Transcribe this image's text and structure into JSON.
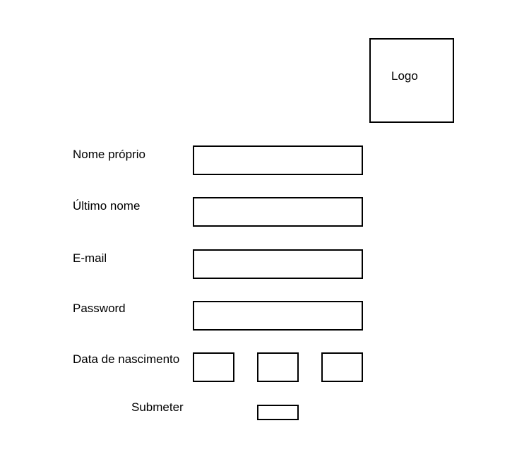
{
  "logo": {
    "text": "Logo"
  },
  "form": {
    "first_name_label": "Nome próprio",
    "last_name_label": "Último nome",
    "email_label": "E-mail",
    "password_label": "Password",
    "birthdate_label": "Data de nascimento",
    "submit_label": "Submeter"
  }
}
